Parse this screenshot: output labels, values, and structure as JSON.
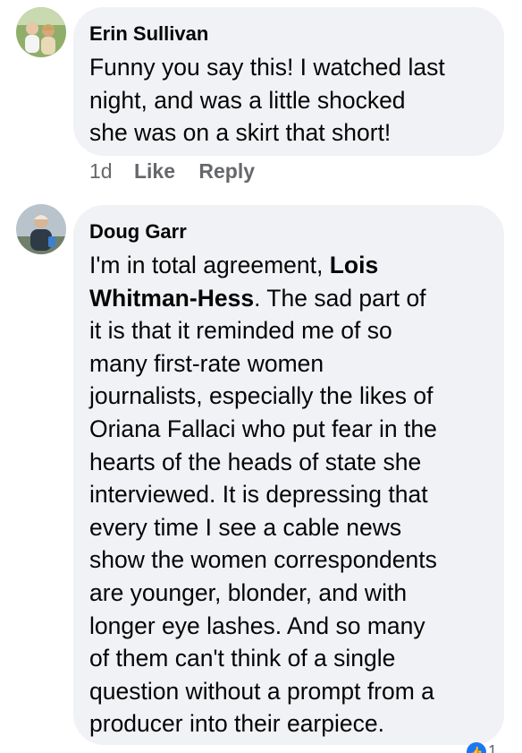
{
  "comments": [
    {
      "author": "Erin Sullivan",
      "avatar_icon": "profile-photo",
      "lines": [
        "Funny you say this! I watched last",
        "night, and was a little shocked",
        "she was on a skirt that short!"
      ],
      "age": "1d",
      "like_label": "Like",
      "reply_label": "Reply"
    },
    {
      "author": "Doug Garr",
      "avatar_icon": "profile-photo",
      "line1_before": "I'm in total agreement, ",
      "mention_part1": "Lois",
      "mention_part2": "Whitman-Hess",
      "line2_after": ". The sad part of",
      "lines_rest": [
        "it is that it reminded me of so",
        "many first-rate women",
        "journalists, especially the likes of",
        "Oriana Fallaci who put fear in the",
        "hearts of the heads of state she",
        "interviewed.  It is depressing that",
        "every time I see a cable news",
        "show the women correspondents",
        "are younger, blonder, and with",
        "longer eye lashes.  And so many",
        "of them can't think of a single",
        "question without a prompt from a",
        "producer into their earpiece."
      ],
      "reaction_icon": "like-icon",
      "reaction_count": "1"
    }
  ],
  "colors": {
    "bubble_bg": "#f0f2f5",
    "text": "#050505",
    "secondary": "#65676b",
    "accent": "#1877f2"
  }
}
